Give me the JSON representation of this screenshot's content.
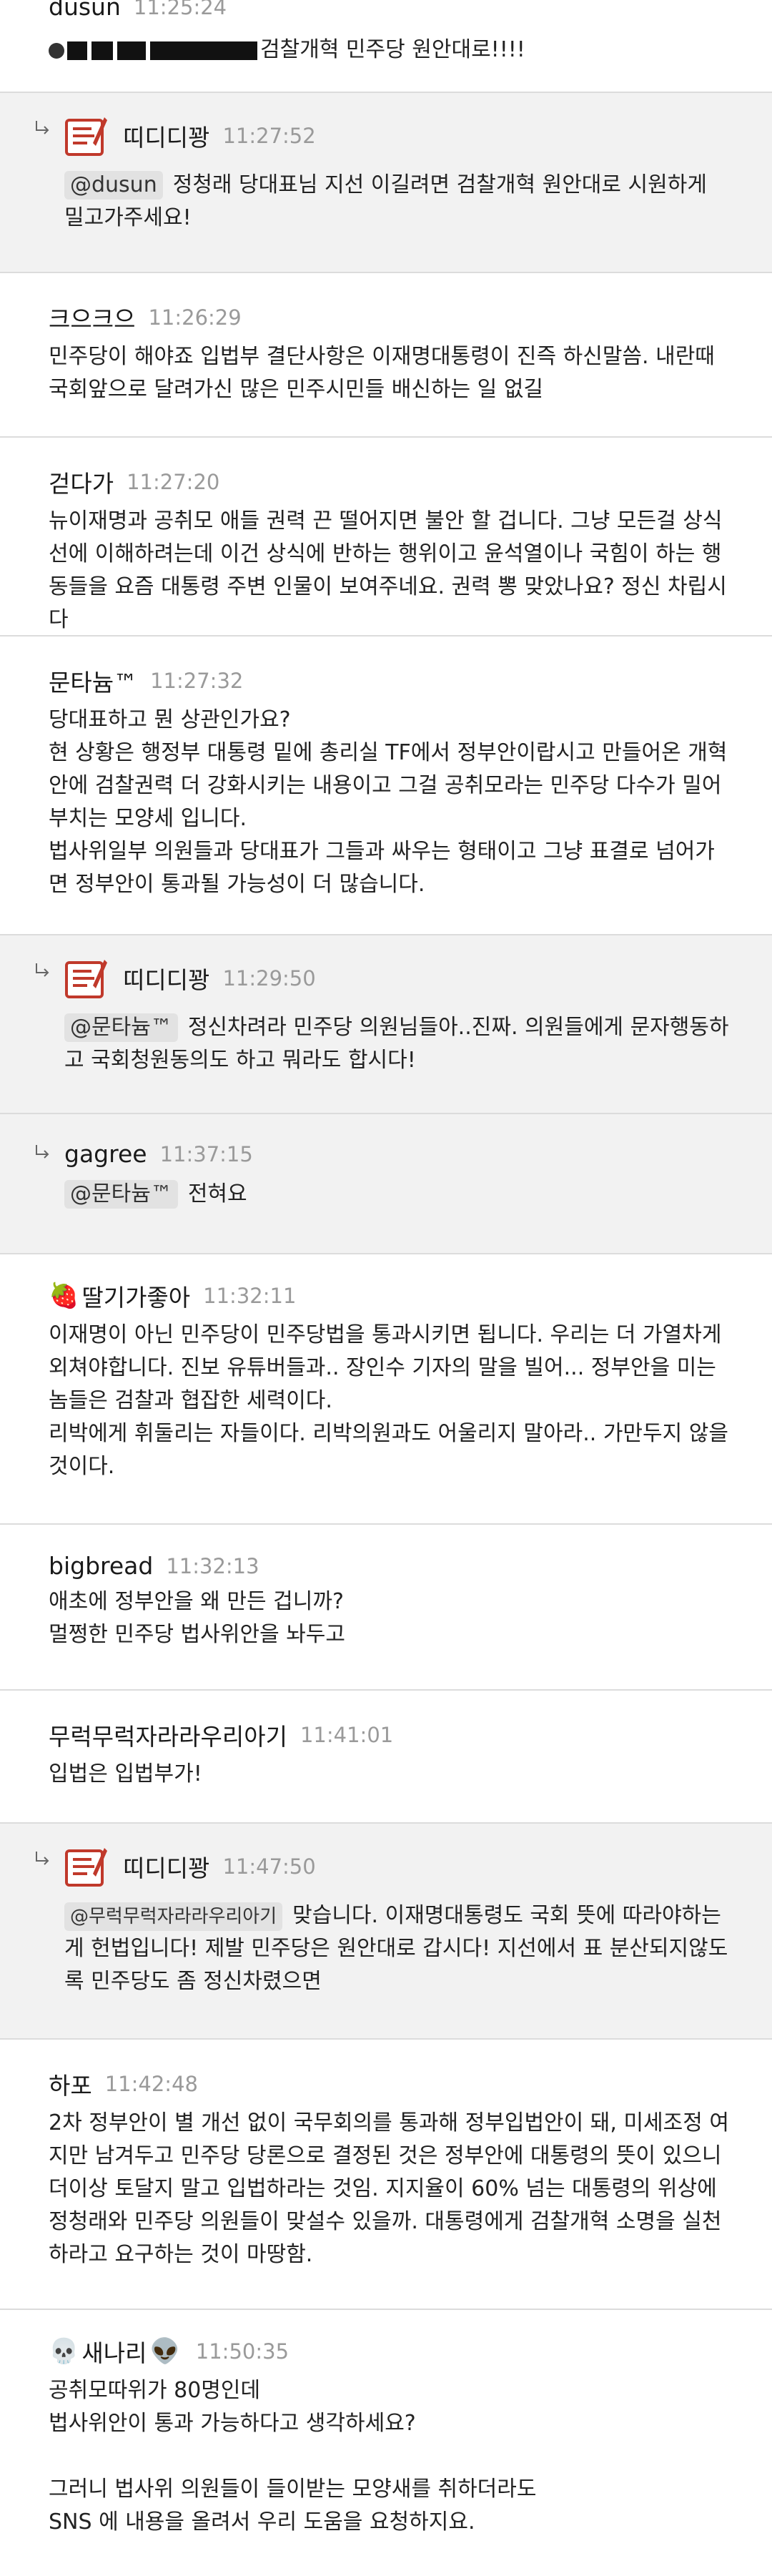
{
  "comments": [
    {
      "nick": "dusun",
      "time": "11:25:24",
      "body": "검찰개혁 민주당 원안대로!!!!"
    },
    {
      "nick": "띠디디꽝",
      "time": "11:27:52",
      "mention": "@dusun",
      "body": "정청래 당대표님 지선 이길려면 검찰개혁 원안대로 시원하게 밀고가주세요!"
    },
    {
      "nick": "크으크으",
      "time": "11:26:29",
      "body": "민주당이 해야죠 입법부 결단사항은 이재명대통령이 진즉 하신말씀. 내란때 국회앞으로 달려가신 많은 민주시민들 배신하는 일 없길"
    },
    {
      "nick": "걷다가",
      "time": "11:27:20",
      "body": "뉴이재명과 공취모 애들 권력 끈 떨어지면 불안 할 겁니다. 그냥 모든걸 상식선에 이해하려는데 이건 상식에 반하는 행위이고 윤석열이나 국힘이 하는 행동들을 요즘 대통령 주변 인물이 보여주네요. 권력 뽕 맞았나요? 정신 차립시다"
    },
    {
      "nick": "문타늄™",
      "time": "11:27:32",
      "paras": [
        "당대표하고 뭔 상관인가요?",
        "현 상황은 행정부 대통령 밑에 총리실 TF에서 정부안이랍시고 만들어온 개혁안에 검찰권력 더 강화시키는 내용이고 그걸 공취모라는 민주당 다수가 밀어부치는 모양세 입니다.",
        "법사위일부 의원들과 당대표가 그들과 싸우는 형태이고 그냥 표결로 넘어가면 정부안이 통과될 가능성이 더 많습니다."
      ]
    },
    {
      "nick": "띠디디꽝",
      "time": "11:29:50",
      "mention": "@문타늄™",
      "body": "정신차려라 민주당 의원님들아..진짜. 의원들에게 문자행동하고 국회청원동의도 하고 뭐라도 합시다!"
    },
    {
      "nick": "gagree",
      "time": "11:37:15",
      "mention": "@문타늄™",
      "body": "전혀요"
    },
    {
      "nick": "딸기가좋아",
      "time": "11:32:11",
      "emoji": "🍓",
      "paras": [
        "이재명이 아닌 민주당이 민주당법을 통과시키면 됩니다. 우리는 더 가열차게 외쳐야합니다. 진보 유튜버들과.. 장인수 기자의 말을 빌어... 정부안을 미는 놈들은 검찰과 협잡한 세력이다.",
        "리박에게 휘둘리는 자들이다. 리박의원과도 어울리지 말아라.. 가만두지 않을 것이다."
      ]
    },
    {
      "nick": "bigbread",
      "time": "11:32:13",
      "paras": [
        "애초에 정부안을 왜 만든 겁니까?",
        "멀쩡한 민주당 법사위안을 놔두고"
      ]
    },
    {
      "nick": "무럭무럭자라라우리아기",
      "time": "11:41:01",
      "body": "입법은 입법부가!"
    },
    {
      "nick": "띠디디꽝",
      "time": "11:47:50",
      "mention": "@무럭무럭자라라우리아기",
      "body": "맞습니다. 이재명대통령도 국회 뜻에 따라야하는게 헌법입니다! 제발 민주당은 원안대로 갑시다! 지선에서 표 분산되지않도록 민주당도 좀 정신차렸으면"
    },
    {
      "nick": "하포",
      "time": "11:42:48",
      "body": "2차 정부안이 별 개선 없이 국무회의를 통과해 정부입법안이 돼, 미세조정 여지만 남겨두고 민주당 당론으로 결정된 것은 정부안에 대통령의 뜻이 있으니 더이상 토달지 말고 입법하라는 것임. 지지율이 60% 넘는 대통령의 위상에 정청래와 민주당 의원들이 맞설수 있을까. 대통령에게 검찰개혁 소명을 실천하라고 요구하는 것이 마땅함."
    },
    {
      "nick": "새나리",
      "time": "11:50:35",
      "emoji_left": "💀",
      "emoji_right": "👽",
      "paras": [
        "공취모따위가 80명인데",
        "법사위안이 통과 가능하다고 생각하세요?",
        "",
        "그러니 법사위 의원들이 들이받는 모양새를 취하더라도",
        "SNS 에 내용을 올려서 우리 도움을 요청하지요."
      ]
    }
  ]
}
